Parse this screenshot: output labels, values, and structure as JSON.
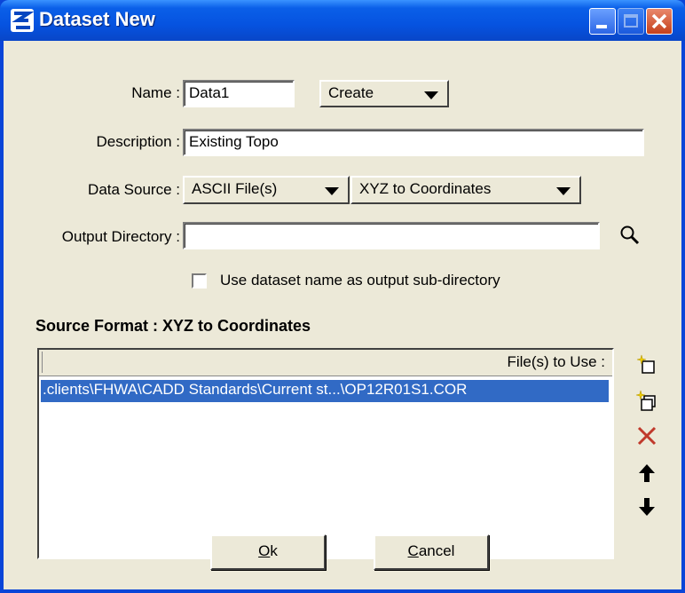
{
  "window": {
    "title": "Dataset New"
  },
  "form": {
    "name_label": "Name :",
    "name_value": "Data1",
    "create_label": "Create",
    "description_label": "Description :",
    "description_value": "Existing Topo",
    "data_source_label": "Data Source :",
    "data_source_value": "ASCII File(s)",
    "data_source_format": "XYZ to Coordinates",
    "output_dir_label": "Output Directory :",
    "output_dir_value": "",
    "use_subdir_label": "Use dataset name as output sub-directory",
    "use_subdir_checked": false
  },
  "source_format": {
    "title": "Source Format : XYZ to Coordinates",
    "column_header": "File(s) to Use :",
    "files": [
      ".clients\\FHWA\\CADD Standards\\Current st...\\OP12R01S1.COR"
    ]
  },
  "icons": {
    "add": "add-file-icon",
    "add_multiple": "add-multiple-icon",
    "remove": "remove-icon",
    "up": "arrow-up-icon",
    "down": "arrow-down-icon",
    "browse": "search-icon"
  },
  "buttons": {
    "ok_prefix": "O",
    "ok_rest": "k",
    "cancel_prefix": "C",
    "cancel_rest": "ancel"
  },
  "colors": {
    "titlebar": "#0653e0",
    "selection": "#316ac5",
    "remove": "#c0392b"
  }
}
